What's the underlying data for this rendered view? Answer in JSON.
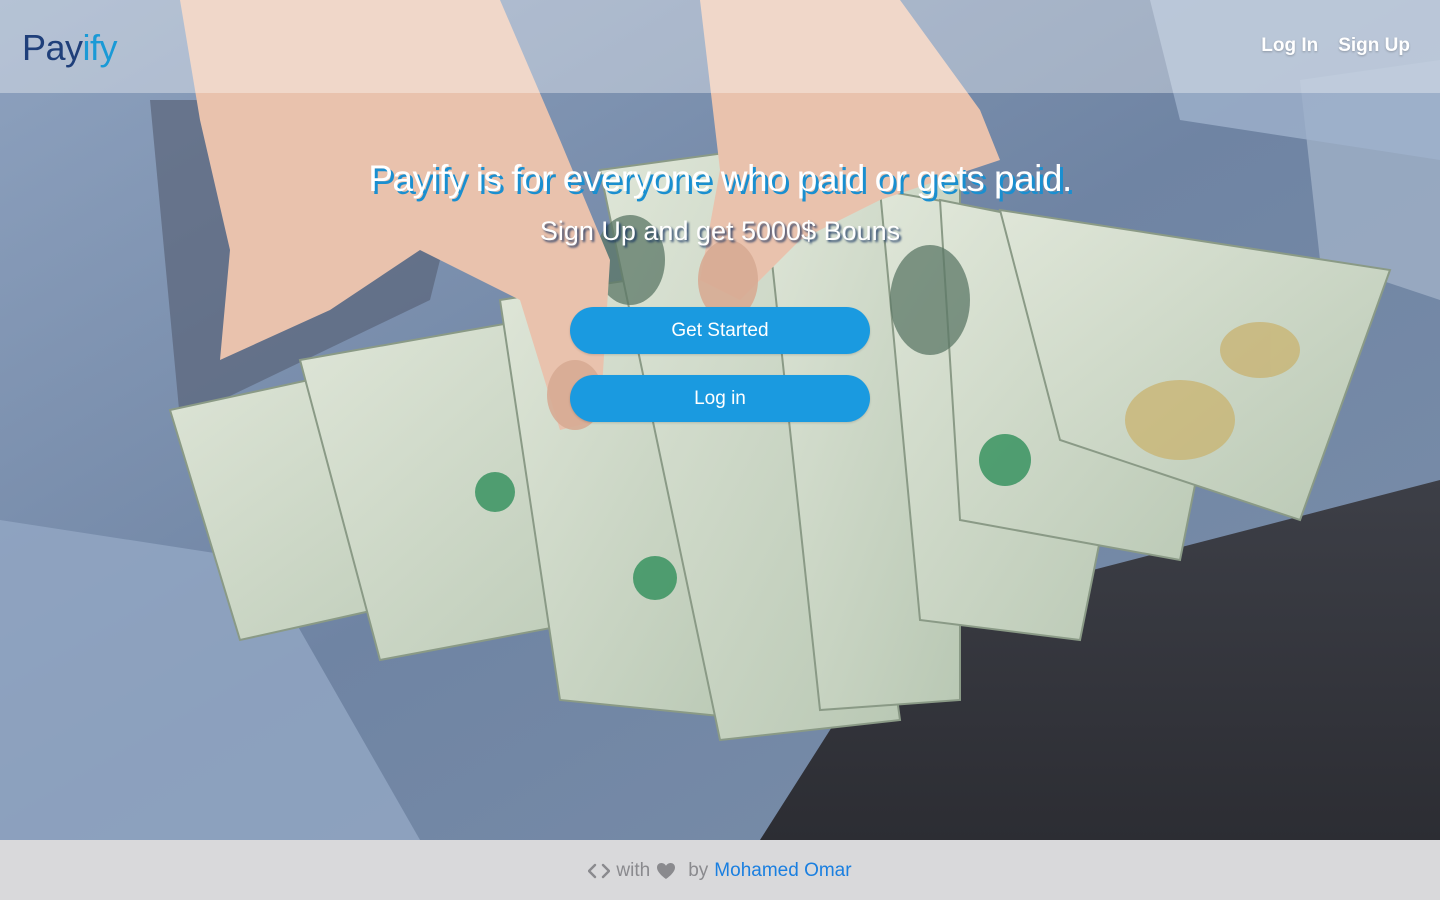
{
  "brand": {
    "name_part1": "Pay",
    "name_part2": "ify",
    "color_primary": "#1f3f7a",
    "color_accent": "#1a9ad6"
  },
  "nav": {
    "login_label": "Log In",
    "signup_label": "Sign Up"
  },
  "hero": {
    "title": "Payify is for everyone who paid or gets paid.",
    "subtitle": "Sign Up and get 5000$ Bouns",
    "get_started_label": "Get Started",
    "login_label": "Log in",
    "button_color": "#1a9ae0"
  },
  "footer": {
    "code_icon": "code-icon",
    "with_text": "with",
    "heart_icon": "heart-icon",
    "by_text": "by",
    "author": "Mohamed Omar",
    "author_color": "#1a7fe0"
  }
}
